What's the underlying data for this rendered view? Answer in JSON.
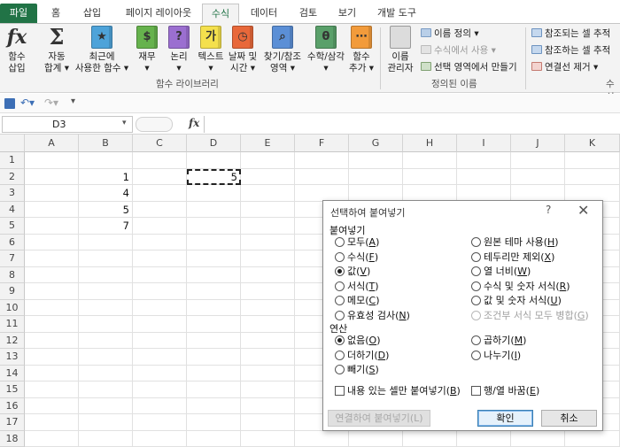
{
  "ribbon_tabs": [
    "파일",
    "홈",
    "삽입",
    "페이지 레이아웃",
    "수식",
    "데이터",
    "검토",
    "보기",
    "개발 도구"
  ],
  "active_tab": "수식",
  "ribbon": {
    "insert_function": [
      "함수",
      "삽입"
    ],
    "autosum": [
      "자동",
      "합계 ▾"
    ],
    "recent": [
      "최근에",
      "사용한 함수 ▾"
    ],
    "financial": [
      "재무",
      "▾"
    ],
    "logical": [
      "논리",
      "▾"
    ],
    "text": [
      "텍스트",
      "▾"
    ],
    "datetime": [
      "날짜 및",
      "시간 ▾"
    ],
    "lookup": [
      "찾기/참조",
      "영역 ▾"
    ],
    "math": [
      "수학/삼각",
      "▾"
    ],
    "more": [
      "함수",
      "추가 ▾"
    ],
    "group_library": "함수 라이브러리",
    "name_manager": [
      "이름",
      "관리자"
    ],
    "define_name": "이름 정의 ▾",
    "use_in_formula": "수식에서 사용 ▾",
    "create_from_selection": "선택 영역에서 만들기",
    "group_defined_names": "정의된 이름",
    "trace_precedents": "참조되는 셀 추적",
    "trace_dependents": "참조하는 셀 추적",
    "remove_arrows": "연결선 제거 ▾",
    "group_audit_partial": "수식",
    "colors": {
      "file_tab": "#217346",
      "text_icon": "#f4e04d",
      "datetime_icon": "#e8683a",
      "lookup_icon": "#5b8fd6",
      "math_icon": "#5aa06a",
      "more_icon": "#f29b3b",
      "recent_icon": "#4ea3d9",
      "financial_icon": "#66b24d",
      "logical_icon": "#9b6fd0"
    }
  },
  "formula_bar": {
    "name_box": "D3",
    "fx_label": "fx",
    "formula": ""
  },
  "sheet": {
    "columns": [
      "A",
      "B",
      "C",
      "D",
      "E",
      "F",
      "G",
      "H",
      "I",
      "J",
      "K"
    ],
    "rows": [
      "1",
      "2",
      "3",
      "4",
      "5",
      "6",
      "7",
      "8",
      "9",
      "10",
      "11",
      "12",
      "13",
      "14",
      "15",
      "16",
      "17",
      "18"
    ],
    "cells": {
      "B2": "1",
      "B3": "4",
      "B4": "5",
      "B5": "7",
      "D2": "5"
    }
  },
  "dialog": {
    "title": "선택하여 붙여넣기",
    "help": "?",
    "close": "✕",
    "paste_section": "붙여넣기",
    "paste_left": [
      {
        "pre": "모두(",
        "key": "A",
        "post": ")",
        "selected": false
      },
      {
        "pre": "수식(",
        "key": "F",
        "post": ")",
        "selected": false
      },
      {
        "pre": "값(",
        "key": "V",
        "post": ")",
        "selected": true
      },
      {
        "pre": "서식(",
        "key": "T",
        "post": ")",
        "selected": false
      },
      {
        "pre": "메모(",
        "key": "C",
        "post": ")",
        "selected": false
      },
      {
        "pre": "유효성 검사(",
        "key": "N",
        "post": ")",
        "selected": false
      }
    ],
    "paste_right": [
      {
        "pre": "원본 테마 사용(",
        "key": "H",
        "post": ")",
        "selected": false,
        "disabled": false
      },
      {
        "pre": "테두리만 제외(",
        "key": "X",
        "post": ")",
        "selected": false,
        "disabled": false
      },
      {
        "pre": "열 너비(",
        "key": "W",
        "post": ")",
        "selected": false,
        "disabled": false
      },
      {
        "pre": "수식 및 숫자 서식(",
        "key": "R",
        "post": ")",
        "selected": false,
        "disabled": false
      },
      {
        "pre": "값 및 숫자 서식(",
        "key": "U",
        "post": ")",
        "selected": false,
        "disabled": false
      },
      {
        "pre": "조건부 서식 모두 병합(",
        "key": "G",
        "post": ")",
        "selected": false,
        "disabled": true
      }
    ],
    "operation_section": "연산",
    "op_left": [
      {
        "pre": "없음(",
        "key": "O",
        "post": ")",
        "selected": true
      },
      {
        "pre": "더하기(",
        "key": "D",
        "post": ")",
        "selected": false
      },
      {
        "pre": "빼기(",
        "key": "S",
        "post": ")",
        "selected": false
      }
    ],
    "op_right": [
      {
        "pre": "곱하기(",
        "key": "M",
        "post": ")",
        "selected": false
      },
      {
        "pre": "나누기(",
        "key": "I",
        "post": ")",
        "selected": false
      }
    ],
    "skip_blanks": {
      "pre": "내용 있는 셀만 붙여넣기(",
      "key": "B",
      "post": ")",
      "checked": false
    },
    "transpose": {
      "pre": "행/열 바꿈(",
      "key": "E",
      "post": ")",
      "checked": false
    },
    "paste_link": "연결하여 붙여넣기(L)",
    "ok": "확인",
    "cancel": "취소"
  }
}
